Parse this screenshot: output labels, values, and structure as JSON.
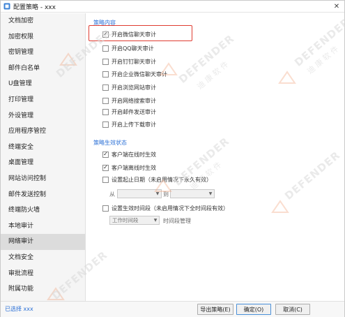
{
  "window": {
    "title": "配置策略 - xxx",
    "close_glyph": "✕"
  },
  "sidebar": {
    "items": [
      {
        "label": "文档加密"
      },
      {
        "label": "加密权限"
      },
      {
        "label": "密钥管理"
      },
      {
        "label": "邮件白名单"
      },
      {
        "label": "U盘管理"
      },
      {
        "label": "打印管理"
      },
      {
        "label": "外设管理"
      },
      {
        "label": "应用程序管控"
      },
      {
        "label": "终端安全"
      },
      {
        "label": "桌面管理"
      },
      {
        "label": "网站访问控制"
      },
      {
        "label": "邮件发送控制"
      },
      {
        "label": "终端防火墙"
      },
      {
        "label": "本地审计"
      },
      {
        "label": "网络审计"
      },
      {
        "label": "文档安全"
      },
      {
        "label": "审批流程"
      },
      {
        "label": "附属功能"
      }
    ],
    "active_index": 14
  },
  "content": {
    "policy_section_title": "策略内容",
    "policy_items": [
      {
        "label": "开启微信聊天审计",
        "checked": true
      },
      {
        "label": "开启QQ聊天审计",
        "checked": false
      },
      {
        "label": "开启钉钉聊天审计",
        "checked": false
      },
      {
        "label": "开启企业微信聊天审计",
        "checked": false
      },
      {
        "label": "开启浏览网站审计",
        "checked": false
      },
      {
        "label": "开启网络搜索审计",
        "checked": false
      },
      {
        "label": "开启邮件发送审计",
        "checked": false
      },
      {
        "label": "开启上传下载审计",
        "checked": false
      }
    ],
    "effect_section_title": "策略生效状态",
    "effect_items": [
      {
        "label": "客户端在线时生效",
        "checked": true
      },
      {
        "label": "客户端离线时生效",
        "checked": true
      },
      {
        "label": "设置起止日期（未启用情况下永久有效）",
        "checked": false
      }
    ],
    "from_label": "从",
    "to_label": "到",
    "time_item": {
      "label": "设置生效时间段（未启用情况下全时间段有效）",
      "checked": false
    },
    "time_select_value": "工作时间段",
    "time_manage_label": "时间段管理",
    "check_glyph": "✓",
    "arrow_glyph": "▼"
  },
  "footer": {
    "selected_info": "已选择 xxx",
    "export_button": "导出策略(E)",
    "ok_button": "确定(O)",
    "cancel_button": "取消(C)"
  },
  "watermark": {
    "brand": "DEFENDER",
    "sub": "迪 康 软 件"
  },
  "colors": {
    "accent": "#2a6fd6",
    "highlight": "#e03c31",
    "sidebar_bg": "#f5f5f5",
    "sidebar_active": "#dcdcdc",
    "watermark_logo": "#f2a27a"
  }
}
